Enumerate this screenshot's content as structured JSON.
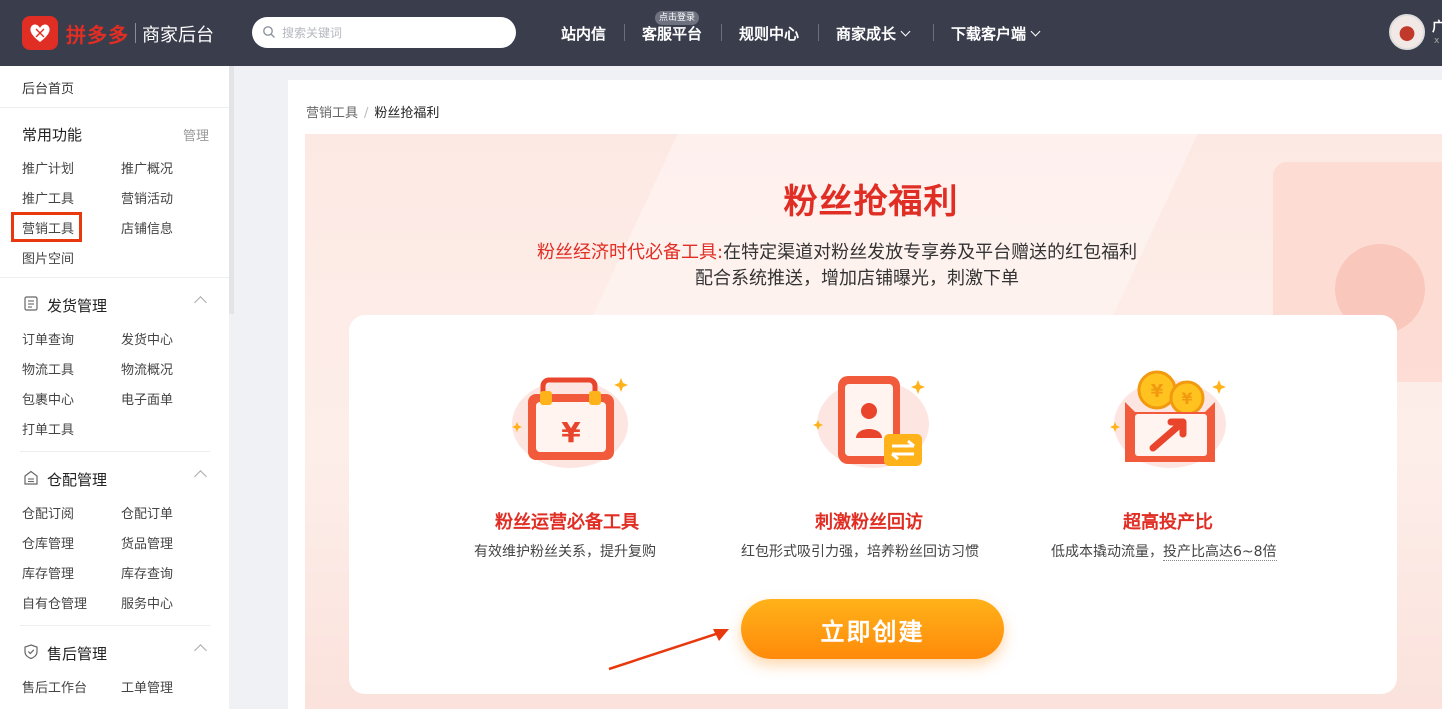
{
  "header": {
    "brand": "拼多多",
    "brand_sub": "商家后台",
    "search_placeholder": "搜索关键词",
    "nav": [
      {
        "label": "站内信"
      },
      {
        "label": "客服平台",
        "badge": "点击登录"
      },
      {
        "label": "规则中心"
      },
      {
        "label": "商家成长"
      },
      {
        "label": "下载客户端"
      }
    ],
    "user_name": "广",
    "user_sub": "x"
  },
  "sidebar": {
    "home": "后台首页",
    "common": {
      "title": "常用功能",
      "manage": "管理",
      "items": [
        "推广计划",
        "推广概况",
        "推广工具",
        "营销活动",
        "营销工具",
        "店铺信息",
        "图片空间"
      ]
    },
    "shipping": {
      "title": "发货管理",
      "items": [
        "订单查询",
        "发货中心",
        "物流工具",
        "物流概况",
        "包裹中心",
        "电子面单",
        "打单工具"
      ]
    },
    "warehouse": {
      "title": "仓配管理",
      "items": [
        "仓配订阅",
        "仓配订单",
        "仓库管理",
        "货品管理",
        "库存管理",
        "库存查询",
        "自有仓管理",
        "服务中心"
      ]
    },
    "aftersale": {
      "title": "售后管理",
      "items": [
        "售后工作台",
        "工单管理"
      ]
    }
  },
  "breadcrumb": {
    "parent": "营销工具",
    "separator": "/",
    "current": "粉丝抢福利"
  },
  "banner": {
    "title": "粉丝抢福利",
    "subtitle_red": "粉丝经济时代必备工具:",
    "subtitle_rest": "在特定渠道对粉丝发放专享券及平台赠送的红包福利",
    "subtitle_line2": "配合系统推送，增加店铺曝光，刺激下单"
  },
  "features": [
    {
      "icon": "toolbox-yuan-icon",
      "title": "粉丝运营必备工具",
      "desc": "有效维护粉丝关系，提升复购"
    },
    {
      "icon": "phone-user-exchange-icon",
      "title": "刺激粉丝回访",
      "desc": "红包形式吸引力强，培养粉丝回访习惯"
    },
    {
      "icon": "coin-box-growth-icon",
      "title": "超高投产比",
      "desc_prefix": "低成本撬动流量，",
      "desc_highlight": "投产比高达6~8倍"
    }
  ],
  "cta": {
    "label": "立即创建"
  },
  "colors": {
    "brand_red": "#e02e24",
    "topbar": "#3a3d4c",
    "cta_orange": "#ff9a12",
    "annotation": "#e8380d"
  }
}
